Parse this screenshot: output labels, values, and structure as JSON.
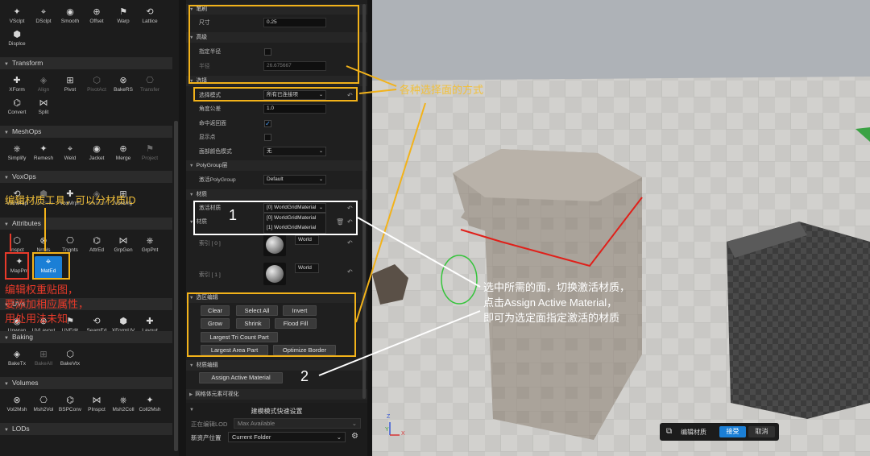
{
  "palette": {
    "sections": [
      {
        "name": "Transform",
        "tools": [
          {
            "label": "XForm",
            "icon": "xform-icon"
          },
          {
            "label": "Align",
            "icon": "align-icon",
            "dim": true
          },
          {
            "label": "Pivot",
            "icon": "pivot-icon"
          },
          {
            "label": "PivotAct",
            "icon": "pivot-act-icon",
            "dim": true
          },
          {
            "label": "BakeRS",
            "icon": "bake-rs-icon"
          },
          {
            "label": "Transfer",
            "icon": "transfer-icon",
            "dim": true
          },
          {
            "label": "Convert",
            "icon": "convert-icon"
          },
          {
            "label": "Split",
            "icon": "split-icon"
          }
        ]
      },
      {
        "name": "MeshOps",
        "tools": [
          {
            "label": "Simplify",
            "icon": "simplify-icon"
          },
          {
            "label": "Remesh",
            "icon": "remesh-icon"
          },
          {
            "label": "Weld",
            "icon": "weld-icon"
          },
          {
            "label": "Jacket",
            "icon": "jacket-icon"
          },
          {
            "label": "Merge",
            "icon": "merge-icon"
          },
          {
            "label": "Project",
            "icon": "project-icon",
            "dim": true
          }
        ]
      },
      {
        "name": "VoxOps",
        "tools": [
          {
            "label": "VoxWrap",
            "icon": "voxwrap-icon"
          },
          {
            "label": "VoxBlnd",
            "icon": "voxblend-icon",
            "dim": true
          },
          {
            "label": "VoxMrph",
            "icon": "voxmorph-icon"
          },
          {
            "label": "VoxBool",
            "icon": "voxbool-icon",
            "dim": true
          },
          {
            "label": "VoxMrg",
            "icon": "voxmerge-icon"
          }
        ]
      },
      {
        "name": "Attributes",
        "tools": [
          {
            "label": "Inspct",
            "icon": "inspect-icon"
          },
          {
            "label": "Nrmls",
            "icon": "normals-icon"
          },
          {
            "label": "Tngnts",
            "icon": "tangents-icon"
          },
          {
            "label": "AttrEd",
            "icon": "attr-edit-icon"
          },
          {
            "label": "GrpGen",
            "icon": "group-gen-icon"
          },
          {
            "label": "GrpPnt",
            "icon": "group-paint-icon"
          },
          {
            "label": "MapPnt",
            "icon": "map-paint-icon"
          },
          {
            "label": "MatEd",
            "icon": "mat-edit-icon",
            "selected": true
          }
        ]
      },
      {
        "name": "UVs",
        "tools": [
          {
            "label": "Unwrap",
            "icon": "unwrap-icon"
          },
          {
            "label": "UVLayout",
            "icon": "uv-layout-icon"
          },
          {
            "label": "UVEdit",
            "icon": "uv-edit-icon"
          },
          {
            "label": "SeamEd",
            "icon": "seam-edit-icon"
          },
          {
            "label": "XFormUV",
            "icon": "xform-uv-icon"
          },
          {
            "label": "Layout",
            "icon": "layout-icon"
          }
        ]
      },
      {
        "name": "Baking",
        "tools": [
          {
            "label": "BakeTx",
            "icon": "bake-tex-icon"
          },
          {
            "label": "BakeAll",
            "icon": "bake-all-icon",
            "dim": true
          },
          {
            "label": "BakeVtx",
            "icon": "bake-vtx-icon"
          }
        ]
      },
      {
        "name": "Volumes",
        "tools": [
          {
            "label": "Vol2Msh",
            "icon": "vol2mesh-icon"
          },
          {
            "label": "Msh2Vol",
            "icon": "mesh2vol-icon"
          },
          {
            "label": "BSPConv",
            "icon": "bspconv-icon"
          },
          {
            "label": "PInspct",
            "icon": "pinspect-icon"
          },
          {
            "label": "Msh2Coll",
            "icon": "mesh2coll-icon"
          },
          {
            "label": "Coll2Msh",
            "icon": "coll2mesh-icon"
          }
        ]
      },
      {
        "name": "LODs",
        "tools": []
      }
    ],
    "top_tools": [
      {
        "label": "VSclpt",
        "icon": "vsculpt-icon"
      },
      {
        "label": "DSclpt",
        "icon": "dsculpt-icon"
      },
      {
        "label": "Smooth",
        "icon": "smooth-icon"
      },
      {
        "label": "Offset",
        "icon": "offset-icon"
      },
      {
        "label": "Warp",
        "icon": "warp-icon"
      },
      {
        "label": "Lattice",
        "icon": "lattice-icon"
      },
      {
        "label": "Displce",
        "icon": "displace-icon"
      }
    ]
  },
  "details": {
    "brush_group": "笔刷",
    "size_label": "尺寸",
    "size_value": "0.25",
    "advanced_group": "高级",
    "specify_radius_label": "指定半径",
    "radius_label": "半径",
    "radius_value": "26.675667",
    "selection_group": "选择",
    "selection_mode_label": "选择模式",
    "selection_mode_value": "所有已连接项",
    "angle_tol_label": "角度公差",
    "angle_tol_value": "1.0",
    "hit_back_label": "命中返回面",
    "show_points_label": "显示点",
    "face_color_label": "面部颜色模式",
    "face_color_value": "无",
    "polygroup_group": "PolyGroup层",
    "active_polygroup_label": "激活PolyGroup",
    "active_polygroup_value": "Default",
    "materials_group": "材质",
    "active_material_label": "激活材质",
    "active_material_value": "[0] WorldGridMaterial",
    "material_options": [
      "[0] WorldGridMaterial",
      "[1] WorldGridMaterial"
    ],
    "materials_sub_label": "材质",
    "index0_label": "索引 [ 0 ]",
    "index1_label": "索引 [ 1 ]",
    "world_label": "World",
    "selection_edit_group": "选区编辑",
    "sel_buttons": [
      "Clear",
      "Select All",
      "Invert",
      "Grow",
      "Shrink",
      "Flood Fill",
      "Largest Tri Count Part",
      "Largest Area Part",
      "Optimize Border"
    ],
    "material_edit_group": "材质编辑",
    "assign_button": "Assign Active Material",
    "mesh_vis_group": "网格体元素可视化"
  },
  "quick_settings": {
    "title": "建模模式快速设置",
    "lod_label": "正在编辑LOD",
    "lod_value": "Max Available",
    "asset_label": "新资产位置",
    "asset_value": "Current Folder"
  },
  "viewport": {
    "tool_name": "编辑材质",
    "accept": "接受",
    "cancel": "取消",
    "axis_x": "X",
    "axis_y": "Y",
    "axis_z": "Z"
  },
  "annotations": {
    "select_methods": "各种选择面的方式",
    "mat_tool": "编辑材质工具，可以分材质ID",
    "map_paint": "编辑权重贴图，\n要添加相应属性，\n用处用法未知",
    "step1": "1",
    "step2": "2",
    "instructions": "选中所需的面，切换激活材质，\n点击Assign Active Material，\n即可为选定面指定激活的材质"
  },
  "colors": {
    "accent": "#1b7fd6",
    "annotation_yellow": "#f2b21a",
    "annotation_red": "#e83a2a"
  }
}
